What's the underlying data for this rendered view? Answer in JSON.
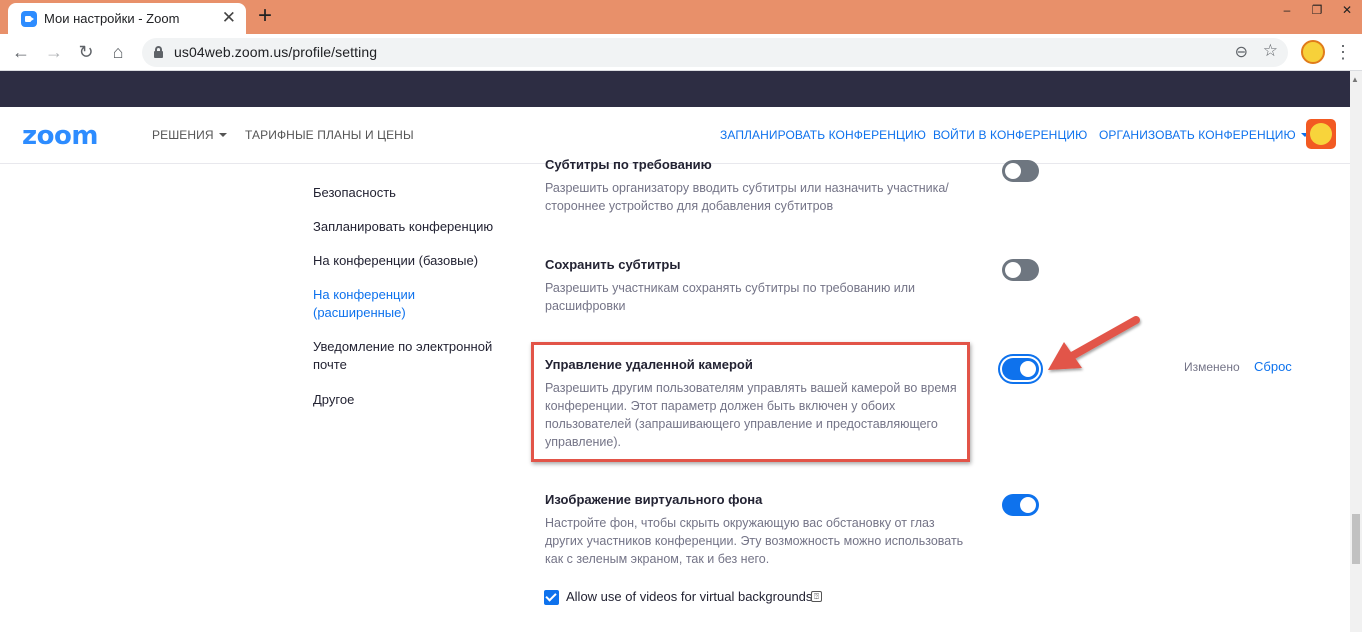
{
  "browser": {
    "tab_title": "Мои настройки - Zoom",
    "tab_close": "✕",
    "new_tab": "+",
    "url": "us04web.zoom.us/profile/setting",
    "win_minimize": "–",
    "win_restore": "❐",
    "win_close": "✕"
  },
  "nav": {
    "back": "←",
    "forward": "→",
    "reload": "↻",
    "home": "⌂",
    "zoom_icon": "⊖",
    "star_icon": "☆",
    "menu_icon": "⋮"
  },
  "header": {
    "logo": "zoom",
    "solutions": "РЕШЕНИЯ",
    "plans": "ТАРИФНЫЕ ПЛАНЫ И ЦЕНЫ",
    "schedule": "ЗАПЛАНИРОВАТЬ КОНФЕРЕНЦИЮ",
    "join": "ВОЙТИ В КОНФЕРЕНЦИЮ",
    "host": "ОРГАНИЗОВАТЬ КОНФЕРЕНЦИЮ"
  },
  "sidebar": {
    "items": [
      {
        "label": "Безопасность"
      },
      {
        "label": "Запланировать конференцию"
      },
      {
        "label": "На конференции (базовые)"
      },
      {
        "label": "На конференции (расширенные)"
      },
      {
        "label": "Уведомление по электронной почте"
      },
      {
        "label": "Другое"
      }
    ]
  },
  "settings": [
    {
      "title": "Субтитры по требованию",
      "desc": "Разрешить организатору вводить субтитры или назначить участника/ стороннее устройство для добавления субтитров",
      "enabled": false
    },
    {
      "title": "Сохранить субтитры",
      "desc": "Разрешить участникам сохранять субтитры по требованию или расшифровки",
      "enabled": false
    },
    {
      "title": "Управление удаленной камерой",
      "desc": "Разрешить другим пользователям управлять вашей камерой во время конференции. Этот параметр должен быть включен у обоих пользователей (запрашивающего управление и предоставляющего управление).",
      "enabled": true,
      "status": "Изменено",
      "reset": "Сброс"
    },
    {
      "title": "Изображение виртуального фона",
      "desc": "Настройте фон, чтобы скрыть окружающую вас обстановку от глаз других участников конференции. Эту возможность можно использовать как с зеленым экраном, так и без него.",
      "enabled": true
    }
  ],
  "checkbox": {
    "label": "Allow use of videos for virtual backgrounds",
    "checked": true,
    "info_icon": "⍰"
  },
  "colors": {
    "accent": "#0e72ed",
    "highlight": "#e25448",
    "dark_band": "#2d2d43",
    "tab_bar": "#e8906a"
  }
}
